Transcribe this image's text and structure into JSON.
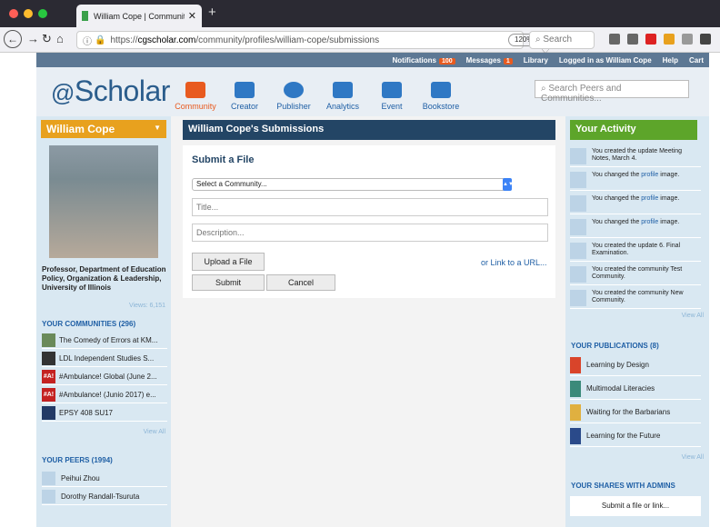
{
  "browser": {
    "tab_title": "William Cope | Community | Sch",
    "tab_close": "✕",
    "new_tab": "+",
    "url_prefix": "https://",
    "url_host": "cgscholar.com",
    "url_path": "/community/profiles/william-cope/submissions",
    "zoom": "120%",
    "search_placeholder": "Search",
    "url_icons": "··· ♡ ☆"
  },
  "topstrip": {
    "notifications": "Notifications",
    "notifications_count": "100",
    "messages": "Messages",
    "messages_count": "1",
    "library": "Library",
    "logged_in": "Logged in as William Cope",
    "help": "Help",
    "cart": "Cart"
  },
  "header": {
    "logo": "Scholar",
    "nav": [
      "Community",
      "Creator",
      "Publisher",
      "Analytics",
      "Event",
      "Bookstore"
    ],
    "search_placeholder": "Search Peers and Communities..."
  },
  "profile": {
    "name": "William Cope",
    "bio": "Professor, Department of Education Policy, Organization & Leadership, University of Illinois",
    "views": "Views: 6,151"
  },
  "communities": {
    "heading": "YOUR COMMUNITIES (296)",
    "items": [
      "The Comedy of Errors at KM...",
      "LDL Independent Studies S...",
      "#Ambulance! Global (June 2...",
      "#Ambulance! (Junio 2017) e...",
      "EPSY 408 SU17"
    ],
    "thumb_text": "#A!",
    "view_all": "View All"
  },
  "peers": {
    "heading": "YOUR PEERS (1994)",
    "items": [
      "Peihui Zhou",
      "Dorothy Randall-Tsuruta"
    ]
  },
  "submissions": {
    "title": "William Cope's Submissions",
    "form_title": "Submit a File",
    "select_value": "Select a Community...",
    "title_placeholder": "Title...",
    "description_placeholder": "Description...",
    "upload": "Upload a File",
    "link": "or Link to a URL...",
    "submit": "Submit",
    "cancel": "Cancel"
  },
  "activity": {
    "heading": "Your Activity",
    "items": [
      {
        "pre": "You created the update",
        "link": "",
        "post": "Meeting Notes, March 4."
      },
      {
        "pre": "You changed the",
        "link": "profile",
        "post": "image."
      },
      {
        "pre": "You changed the",
        "link": "profile",
        "post": "image."
      },
      {
        "pre": "You changed the",
        "link": "profile",
        "post": "image."
      },
      {
        "pre": "You created the update",
        "link": "",
        "post": "6. Final Examination."
      },
      {
        "pre": "You created the community",
        "link": "",
        "post": "Test Community."
      },
      {
        "pre": "You created the community",
        "link": "",
        "post": "New Community."
      }
    ],
    "view_all": "View All"
  },
  "publications": {
    "heading": "YOUR PUBLICATIONS (8)",
    "items": [
      "Learning by Design",
      "Multimodal Literacies",
      "Waiting for the Barbarians",
      "Learning for the Future"
    ],
    "view_all": "View All"
  },
  "shares": {
    "heading": "YOUR SHARES WITH ADMINS",
    "action": "Submit a file or link..."
  }
}
